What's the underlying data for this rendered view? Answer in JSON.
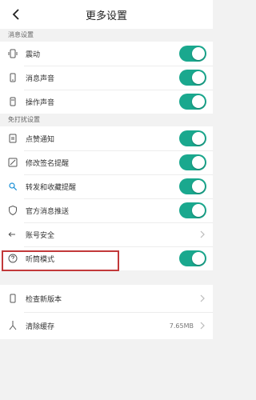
{
  "header": {
    "title": "更多设置",
    "back_icon": "back-arrow-icon"
  },
  "sections": {
    "message": {
      "title": "消息设置",
      "items": [
        {
          "label": "震动",
          "icon": "vibrate-icon",
          "toggle": true
        },
        {
          "label": "消息声音",
          "icon": "bell-icon",
          "toggle": true
        },
        {
          "label": "操作声音",
          "icon": "bell-icon",
          "toggle": true
        }
      ]
    },
    "no_disturb": {
      "title": "免打扰设置",
      "items": [
        {
          "label": "点赞通知",
          "icon": "like-icon",
          "toggle": true
        },
        {
          "label": "修改签名提醒",
          "icon": "edit-signature-icon",
          "toggle": true
        },
        {
          "label": "转发和收藏提醒",
          "icon": "share-icon",
          "toggle": true
        },
        {
          "label": "官方消息推送",
          "icon": "shield-icon",
          "toggle": true
        },
        {
          "label": "账号安全",
          "icon": "key-icon",
          "toggle": null
        },
        {
          "label": "听筒模式",
          "icon": "earpiece-icon",
          "toggle": true
        }
      ]
    },
    "other": {
      "items": [
        {
          "label": "检查新版本",
          "icon": "phone-icon"
        },
        {
          "label": "清除缓存",
          "icon": "broom-icon",
          "value": "7.65MB"
        }
      ]
    }
  },
  "colors": {
    "accent": "#1aa88e",
    "highlight": "#c2393a",
    "background": "#f2f2f2"
  }
}
